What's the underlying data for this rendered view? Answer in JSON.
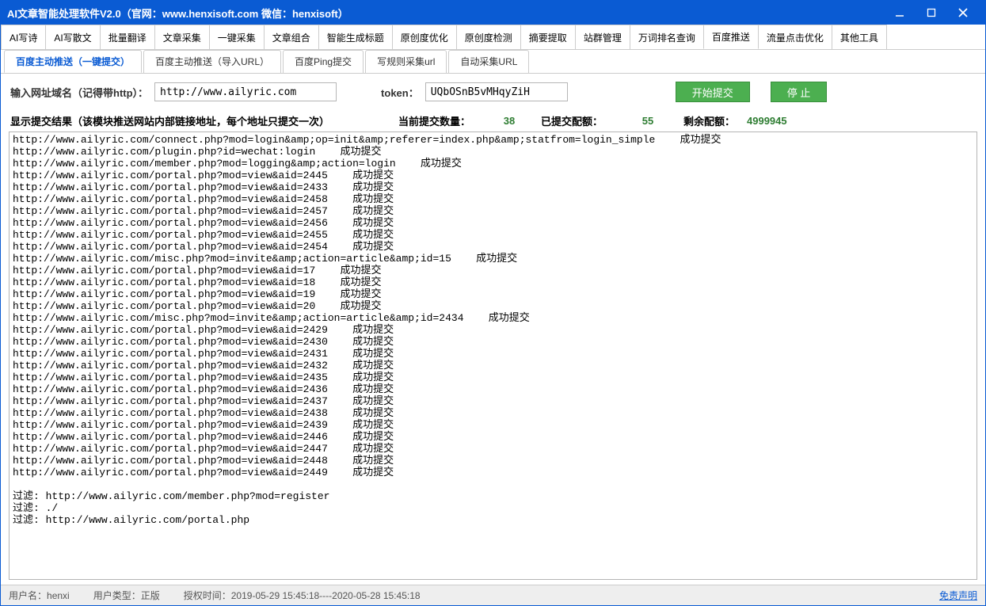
{
  "title": "AI文章智能处理软件V2.0（官网：www.henxisoft.com  微信：henxisoft）",
  "main_tabs": [
    "AI写诗",
    "AI写散文",
    "批量翻译",
    "文章采集",
    "一键采集",
    "文章组合",
    "智能生成标题",
    "原创度优化",
    "原创度检测",
    "摘要提取",
    "站群管理",
    "万词排名查询",
    "百度推送",
    "流量点击优化",
    "其他工具"
  ],
  "active_main_tab": 12,
  "sub_tabs": [
    "百度主动推送（一键提交）",
    "百度主动推送（导入URL）",
    "百度Ping提交",
    "写规则采集url",
    "自动采集URL"
  ],
  "active_sub_tab": 0,
  "form": {
    "domain_label": "输入网址域名（记得带http）：",
    "domain_value": "http://www.ailyric.com",
    "token_label": "token：",
    "token_value": "UQbOSnB5vMHqyZiH",
    "start_btn": "开始提交",
    "stop_btn": "停 止"
  },
  "stats": {
    "result_label": "显示提交结果（该模块推送网站内部链接地址，每个地址只提交一次）",
    "current_label": "当前提交数量：",
    "current_value": "38",
    "submitted_label": "已提交配额：",
    "submitted_value": "55",
    "remaining_label": "剩余配额：",
    "remaining_value": "4999945"
  },
  "results": [
    "http://www.ailyric.com/connect.php?mod=login&amp;op=init&amp;referer=index.php&amp;statfrom=login_simple    成功提交",
    "http://www.ailyric.com/plugin.php?id=wechat:login    成功提交",
    "http://www.ailyric.com/member.php?mod=logging&amp;action=login    成功提交",
    "http://www.ailyric.com/portal.php?mod=view&aid=2445    成功提交",
    "http://www.ailyric.com/portal.php?mod=view&aid=2433    成功提交",
    "http://www.ailyric.com/portal.php?mod=view&aid=2458    成功提交",
    "http://www.ailyric.com/portal.php?mod=view&aid=2457    成功提交",
    "http://www.ailyric.com/portal.php?mod=view&aid=2456    成功提交",
    "http://www.ailyric.com/portal.php?mod=view&aid=2455    成功提交",
    "http://www.ailyric.com/portal.php?mod=view&aid=2454    成功提交",
    "http://www.ailyric.com/misc.php?mod=invite&amp;action=article&amp;id=15    成功提交",
    "http://www.ailyric.com/portal.php?mod=view&aid=17    成功提交",
    "http://www.ailyric.com/portal.php?mod=view&aid=18    成功提交",
    "http://www.ailyric.com/portal.php?mod=view&aid=19    成功提交",
    "http://www.ailyric.com/portal.php?mod=view&aid=20    成功提交",
    "http://www.ailyric.com/misc.php?mod=invite&amp;action=article&amp;id=2434    成功提交",
    "http://www.ailyric.com/portal.php?mod=view&aid=2429    成功提交",
    "http://www.ailyric.com/portal.php?mod=view&aid=2430    成功提交",
    "http://www.ailyric.com/portal.php?mod=view&aid=2431    成功提交",
    "http://www.ailyric.com/portal.php?mod=view&aid=2432    成功提交",
    "http://www.ailyric.com/portal.php?mod=view&aid=2435    成功提交",
    "http://www.ailyric.com/portal.php?mod=view&aid=2436    成功提交",
    "http://www.ailyric.com/portal.php?mod=view&aid=2437    成功提交",
    "http://www.ailyric.com/portal.php?mod=view&aid=2438    成功提交",
    "http://www.ailyric.com/portal.php?mod=view&aid=2439    成功提交",
    "http://www.ailyric.com/portal.php?mod=view&aid=2446    成功提交",
    "http://www.ailyric.com/portal.php?mod=view&aid=2447    成功提交",
    "http://www.ailyric.com/portal.php?mod=view&aid=2448    成功提交",
    "http://www.ailyric.com/portal.php?mod=view&aid=2449    成功提交",
    "",
    "过滤: http://www.ailyric.com/member.php?mod=register",
    "过滤: ./",
    "过滤: http://www.ailyric.com/portal.php"
  ],
  "status": {
    "user_label": "用户名：",
    "user_value": "henxi",
    "type_label": "用户类型：",
    "type_value": "正版",
    "auth_label": "授权时间：",
    "auth_value": "2019-05-29 15:45:18----2020-05-28 15:45:18",
    "disclaimer": "免责声明"
  }
}
